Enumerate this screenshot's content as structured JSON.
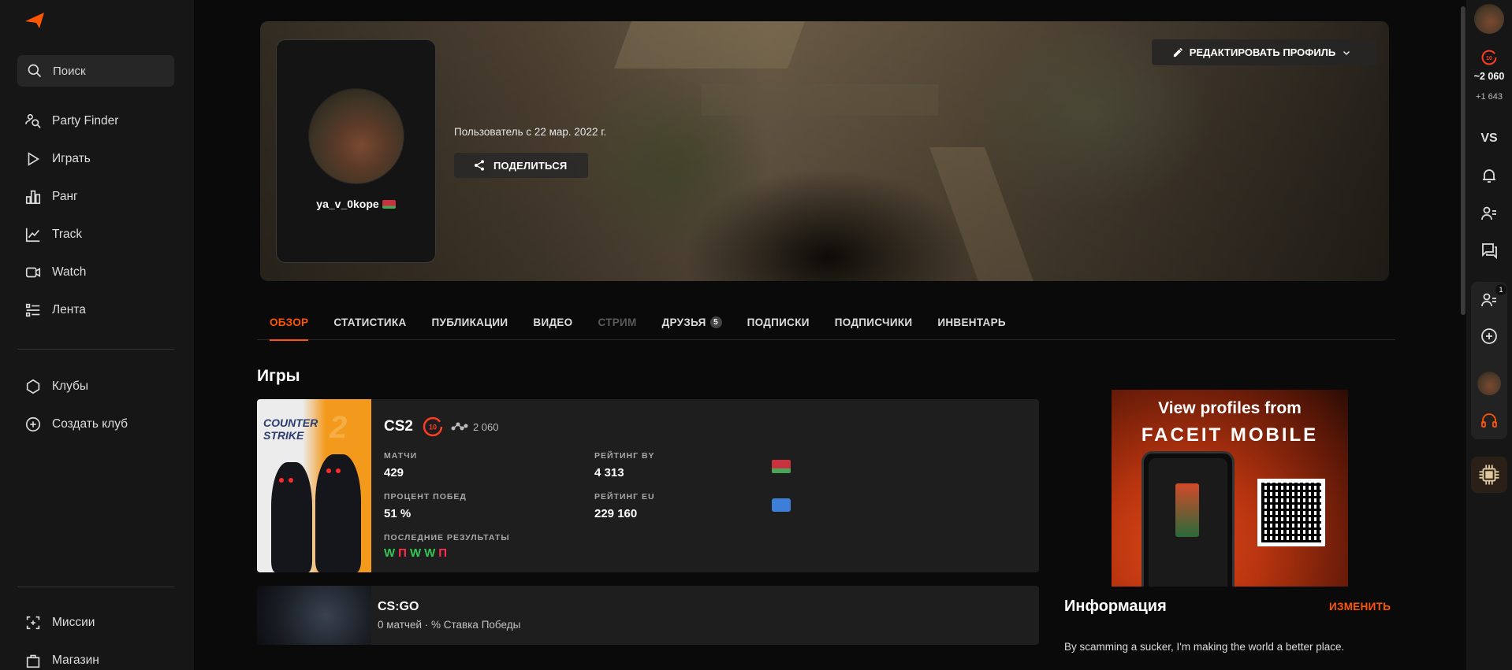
{
  "sidebar": {
    "search_label": "Поиск",
    "items": [
      {
        "label": "Party Finder",
        "icon": "party-finder-icon"
      },
      {
        "label": "Играть",
        "icon": "play-icon"
      },
      {
        "label": "Ранг",
        "icon": "rank-icon"
      },
      {
        "label": "Track",
        "icon": "track-icon"
      },
      {
        "label": "Watch",
        "icon": "watch-icon"
      },
      {
        "label": "Лента",
        "icon": "feed-icon"
      }
    ],
    "clubs": [
      {
        "label": "Клубы",
        "icon": "clubs-icon"
      },
      {
        "label": "Создать клуб",
        "icon": "plus-circle-icon"
      }
    ],
    "bottom": [
      {
        "label": "Миссии",
        "icon": "missions-icon"
      },
      {
        "label": "Магазин",
        "icon": "shop-icon"
      }
    ]
  },
  "profile": {
    "nickname": "ya_v_0kope",
    "member_since": "Пользователь с 22 мар. 2022 г.",
    "share_label": "ПОДЕЛИТЬСЯ",
    "edit_label": "РЕДАКТИРОВАТЬ ПРОФИЛЬ"
  },
  "tabs": [
    {
      "label": "ОБЗОР",
      "state": "active"
    },
    {
      "label": "СТАТИСТИКА",
      "state": "normal"
    },
    {
      "label": "ПУБЛИКАЦИИ",
      "state": "normal"
    },
    {
      "label": "ВИДЕО",
      "state": "normal"
    },
    {
      "label": "СТРИМ",
      "state": "disabled"
    },
    {
      "label": "ДРУЗЬЯ",
      "state": "normal",
      "count": "5"
    },
    {
      "label": "ПОДПИСКИ",
      "state": "normal"
    },
    {
      "label": "ПОДПИСЧИКИ",
      "state": "normal"
    },
    {
      "label": "ИНВЕНТАРЬ",
      "state": "normal"
    }
  ],
  "games_title": "Игры",
  "cs2": {
    "cover_text_1": "COUNTER",
    "cover_text_2": "STRIKE",
    "cover_number": "2",
    "title": "CS2",
    "level": "10",
    "elo": "2 060",
    "matches_label": "МАТЧИ",
    "matches_value": "429",
    "winrate_label": "ПРОЦЕНТ ПОБЕД",
    "winrate_value": "51 %",
    "rating_by_label": "РЕЙТИНГ BY",
    "rating_by_value": "4 313",
    "rating_eu_label": "РЕЙТИНГ EU",
    "rating_eu_value": "229 160",
    "recent_label": "ПОСЛЕДНИЕ РЕЗУЛЬТАТЫ",
    "recent_results": [
      "W",
      "П",
      "W",
      "W",
      "П"
    ],
    "win_color": "#32c755",
    "loss_color": "#ff2e4d"
  },
  "csgo": {
    "title": "CS:GO",
    "subtitle": "0 матчей · % Ставка Победы"
  },
  "ad": {
    "line1": "View profiles from",
    "line2": "FACEIT MOBILE"
  },
  "info": {
    "title": "Информация",
    "edit_label": "ИЗМЕНИТЬ",
    "text": "By scamming a sucker, I'm making the world a better place."
  },
  "rightbar": {
    "level": "10",
    "elo": "~2 060",
    "elo_change": "+1 643",
    "vs_label": "VS",
    "party_count": "1"
  },
  "colors": {
    "accent": "#ff5500",
    "sidebar_bg": "#161616",
    "card_bg": "#1e1e1e"
  }
}
